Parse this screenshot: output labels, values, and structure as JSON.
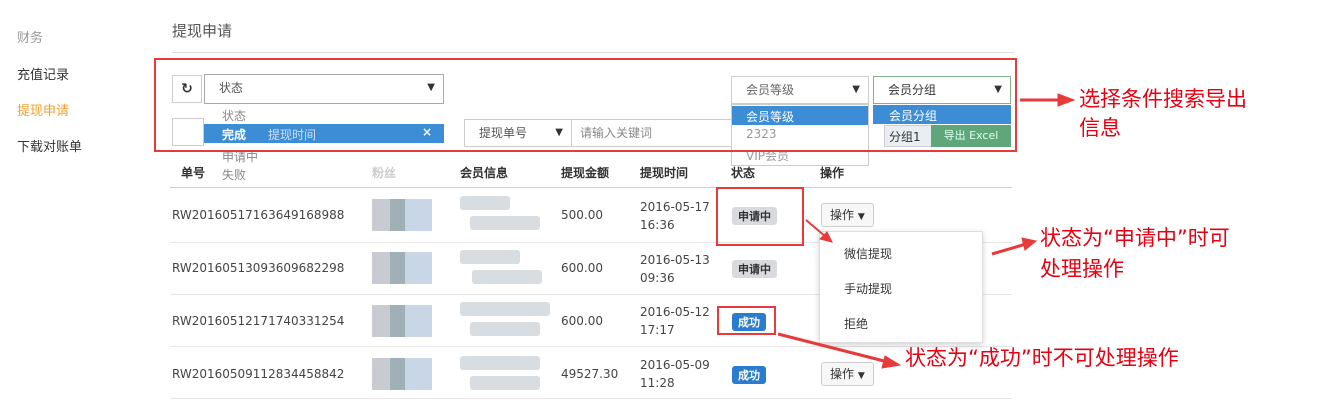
{
  "sidebar": {
    "section": "财务",
    "items": [
      {
        "label": "充值记录"
      },
      {
        "label": "提现申请"
      },
      {
        "label": "下载对账单"
      }
    ]
  },
  "page_title": "提现申请",
  "filters": {
    "status_select": {
      "value": "状态",
      "options": [
        "状态",
        "完成",
        "申请中",
        "失败"
      ]
    },
    "time_placeholder": "提现时间",
    "member_level_select": {
      "value": "会员等级",
      "options": [
        "会员等级",
        "2323",
        "VIP会员"
      ]
    },
    "member_group_select": {
      "value": "会员分组",
      "options": [
        "会员分组",
        "分组1"
      ]
    },
    "export_label": "导出 Excel",
    "search_field": "提现单号",
    "keyword_placeholder": "请输入关键词"
  },
  "table": {
    "headers": [
      "单号",
      "粉丝",
      "会员信息",
      "提现金额",
      "提现时间",
      "状态",
      "操作"
    ],
    "rows": [
      {
        "id": "RW20160517163649168988",
        "amount": "500.00",
        "date": "2016-05-17",
        "time": "16:36",
        "status": "申请中",
        "op": "操作"
      },
      {
        "id": "RW20160513093609682298",
        "amount": "600.00",
        "date": "2016-05-13",
        "time": "09:36",
        "status": "申请中",
        "op": ""
      },
      {
        "id": "RW20160512171740331254",
        "amount": "600.00",
        "date": "2016-05-12",
        "time": "17:17",
        "status": "成功",
        "op": ""
      },
      {
        "id": "RW20160509112834458842",
        "amount": "49527.30",
        "date": "2016-05-09",
        "time": "11:28",
        "status": "成功",
        "op": "操作"
      }
    ]
  },
  "op_menu": [
    "微信提现",
    "手动提现",
    "拒绝"
  ],
  "annotations": {
    "filter_line1": "选择条件搜索导出",
    "filter_line2": "信息",
    "pending_line1": "状态为“申请中”时可",
    "pending_line2": "处理操作",
    "success": "状态为“成功”时不可处理操作"
  },
  "colors": {
    "accent": "#f0a030",
    "highlight": "#3c8dd6",
    "annotation": "#e60012",
    "success_badge": "#2a7ccf"
  }
}
